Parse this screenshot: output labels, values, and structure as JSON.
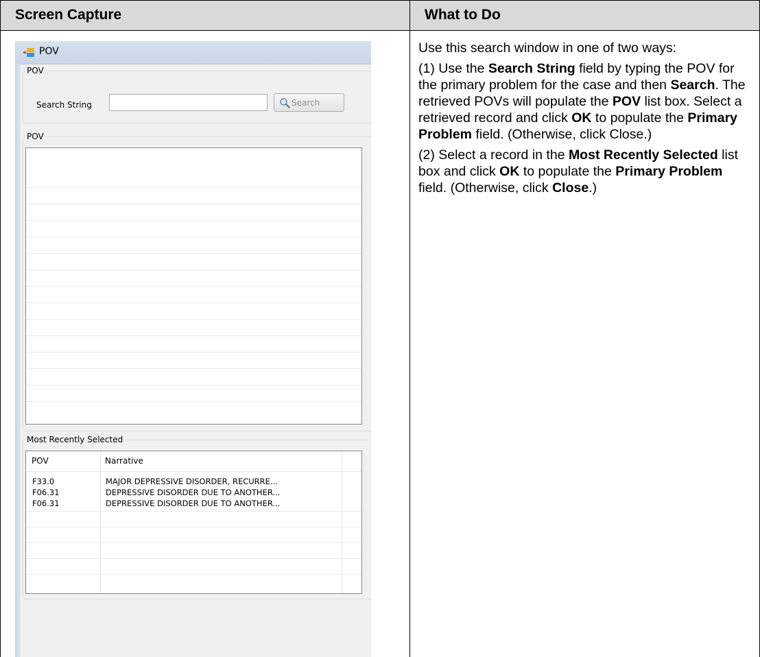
{
  "table": {
    "col1_header": "Screen Capture",
    "col2_header": "What to Do"
  },
  "instructions": {
    "p1": "Use this search window in one of two ways:",
    "p2_parts": {
      "a": "(1) Use the ",
      "b": "Search String",
      "c": " field by typing the POV for the primary problem for the case and then ",
      "d": "Search",
      "e": ". The retrieved POVs will populate the ",
      "f": "POV",
      "g": " list box. Select a retrieved record and click ",
      "h": "OK",
      "i": " to populate the ",
      "j": "Primary Problem",
      "k": " field. (Otherwise, click Close.)"
    },
    "p3_parts": {
      "a": "(2) Select a record in the ",
      "b": "Most Recently Selected",
      "c": " list box and click ",
      "d": "OK",
      "e": " to populate the ",
      "f": "Primary Problem",
      "g": " field. (Otherwise, click ",
      "h": "Close",
      "i": ".)"
    }
  },
  "window": {
    "title": "POV",
    "icon": "window-app-icon",
    "search_group_label": "POV",
    "search_label": "Search String",
    "search_value": "",
    "search_button_label": "Search",
    "results_group_label": "POV",
    "recent_group_label": "Most Recently Selected",
    "recent_columns": [
      "POV",
      "Narrative"
    ],
    "recent_rows": [
      {
        "pov": "F33.0",
        "narrative": "MAJOR DEPRESSIVE DISORDER, RECURRE..."
      },
      {
        "pov": "F06.31",
        "narrative": "DEPRESSIVE DISORDER DUE TO ANOTHER..."
      },
      {
        "pov": "F06.31",
        "narrative": "DEPRESSIVE DISORDER DUE TO ANOTHER..."
      }
    ]
  }
}
